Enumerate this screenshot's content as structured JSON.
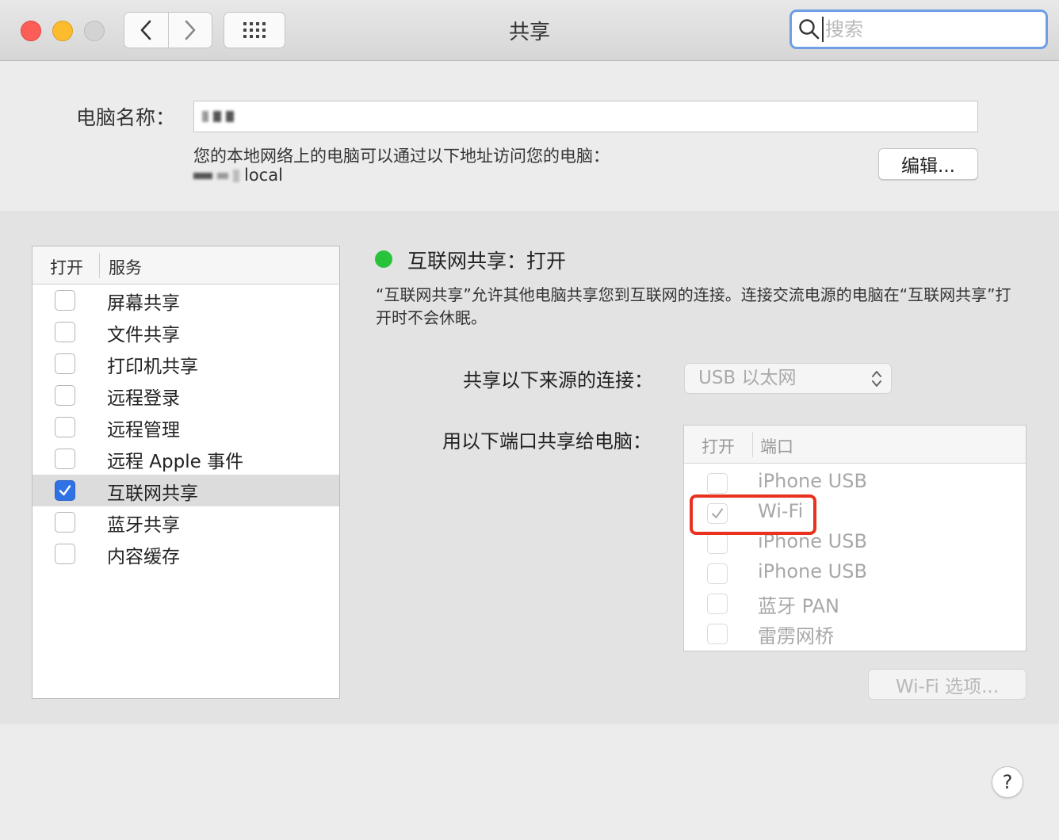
{
  "window": {
    "title": "共享",
    "search_placeholder": "搜索"
  },
  "toolbar": {
    "back_icon": "chevron-left-icon",
    "forward_icon": "chevron-right-icon",
    "grid_icon": "grid-icon"
  },
  "computer": {
    "name_label": "电脑名称：",
    "address_desc": "您的本地网络上的电脑可以通过以下地址访问您的电脑：",
    "address_suffix": "local",
    "edit_label": "编辑..."
  },
  "services": {
    "header_open": "打开",
    "header_service": "服务",
    "items": [
      {
        "label": "屏幕共享",
        "checked": false
      },
      {
        "label": "文件共享",
        "checked": false
      },
      {
        "label": "打印机共享",
        "checked": false
      },
      {
        "label": "远程登录",
        "checked": false
      },
      {
        "label": "远程管理",
        "checked": false
      },
      {
        "label": "远程 Apple 事件",
        "checked": false
      },
      {
        "label": "互联网共享",
        "checked": true,
        "selected": true
      },
      {
        "label": "蓝牙共享",
        "checked": false
      },
      {
        "label": "内容缓存",
        "checked": false
      }
    ]
  },
  "detail": {
    "status_title": "互联网共享：打开",
    "status_color": "#29c33b",
    "description": "“互联网共享”允许其他电脑共享您到互联网的连接。连接交流电源的电脑在“互联网共享”打开时不会休眠。",
    "source_label": "共享以下来源的连接：",
    "source_value": "USB 以太网",
    "ports_label": "用以下端口共享给电脑：",
    "ports_header_open": "打开",
    "ports_header_port": "端口",
    "ports": [
      {
        "label": "iPhone USB",
        "checked": false
      },
      {
        "label": "Wi-Fi",
        "checked": true
      },
      {
        "label": "iPhone USB",
        "checked": false
      },
      {
        "label": "iPhone USB",
        "checked": false
      },
      {
        "label": "蓝牙 PAN",
        "checked": false
      },
      {
        "label": "雷雳网桥",
        "checked": false
      }
    ],
    "wifi_options_label": "Wi-Fi 选项...",
    "highlight_color": "#e8321f"
  },
  "help": {
    "label": "?"
  }
}
